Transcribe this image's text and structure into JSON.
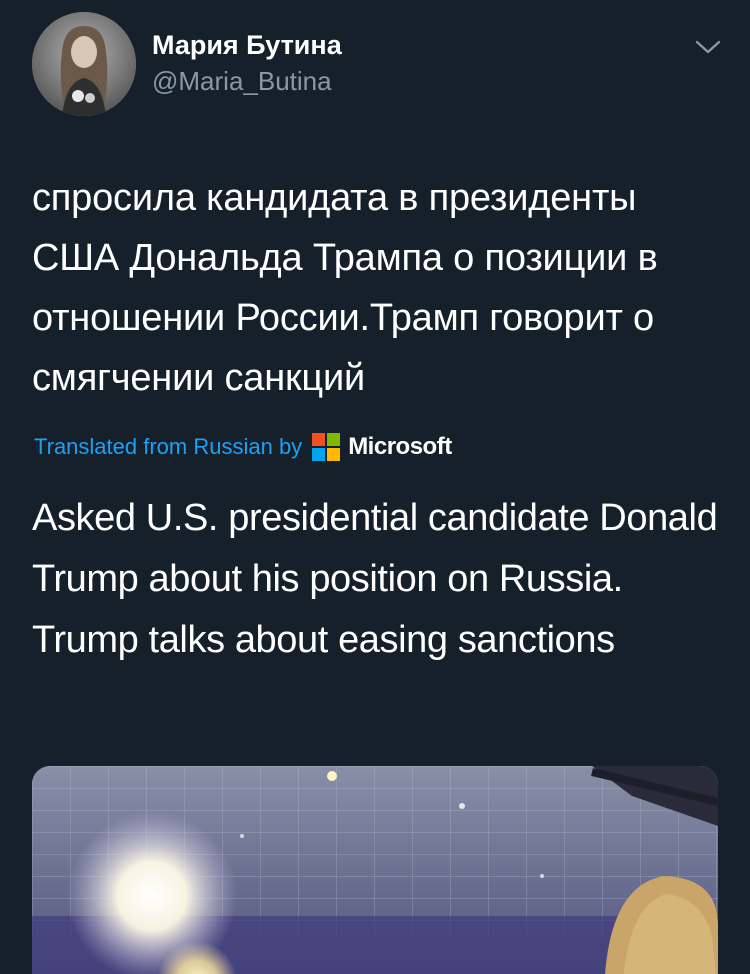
{
  "author": {
    "name": "Мария Бутина",
    "handle": "@Maria_Butina"
  },
  "icons": {
    "caret": "chevron-down-icon",
    "avatar": "profile-photo",
    "translator_logo": "microsoft-logo-icon"
  },
  "tweet": {
    "text": "спросила кандидата в президенты США Дональда Трампа о позиции в отношении России.Трамп говорит о смягчении санкций"
  },
  "translation": {
    "label": "Translated from Russian by",
    "provider": "Microsoft",
    "text": "Asked U.S. presidential candidate Donald Trump about his position on Russia. Trump talks about easing sanctions"
  },
  "colors": {
    "background": "#15202b",
    "primary_text": "#ffffff",
    "secondary_text": "#8899a6",
    "link": "#1da1f2",
    "ms_red": "#f25022",
    "ms_green": "#7fba00",
    "ms_blue": "#00a4ef",
    "ms_yellow": "#ffb900"
  }
}
